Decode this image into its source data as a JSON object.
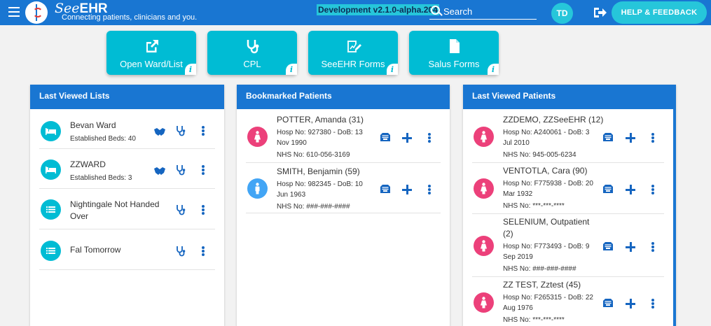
{
  "header": {
    "brand_name": "SeeEHR",
    "brand_prefix": "See",
    "brand_suffix": "EHR",
    "tagline": "Connecting patients, clinicians and you.",
    "environment": "Development v2.1.0-alpha.204",
    "search_placeholder": "Search",
    "avatar_initials": "TD",
    "help_label": "HELP & FEEDBACK"
  },
  "tiles": [
    {
      "label": "Open Ward/List",
      "icon": "external-link-icon"
    },
    {
      "label": "CPL",
      "icon": "stethoscope-icon"
    },
    {
      "label": "SeeEHR Forms",
      "icon": "form-edit-icon"
    },
    {
      "label": "Salus Forms",
      "icon": "document-icon"
    }
  ],
  "last_viewed_lists": {
    "title": "Last Viewed Lists",
    "items": [
      {
        "name": "Bevan Ward",
        "detail": "Established Beds: 40",
        "icon": "bed-icon"
      },
      {
        "name": "ZZWARD",
        "detail": "Established Beds: 3",
        "icon": "bed-icon"
      },
      {
        "name": "Nightingale Not Handed",
        "name_line2": "Over",
        "detail": "",
        "icon": "list-icon"
      },
      {
        "name": "Fal Tomorrow",
        "detail": "",
        "icon": "list-icon"
      }
    ]
  },
  "bookmarked_patients": {
    "title": "Bookmarked Patients",
    "items": [
      {
        "name": "POTTER, Amanda (31)",
        "hosp_line1": "Hosp No: 927380 - DoB: 13",
        "hosp_line2": "Nov 1990",
        "nhs": "NHS No: 610-056-3169",
        "gender": "female"
      },
      {
        "name": "SMITH, Benjamin (59)",
        "hosp_line1": "Hosp No: 982345 - DoB: 10",
        "hosp_line2": "Jun 1963",
        "nhs": "NHS No: ###-###-####",
        "gender": "male"
      }
    ]
  },
  "last_viewed_patients": {
    "title": "Last Viewed Patients",
    "items": [
      {
        "name": "ZZDEMO, ZZSeeEHR (12)",
        "hosp_line1": "Hosp No: A240061 - DoB: 3",
        "hosp_line2": "Jul 2010",
        "nhs": "NHS No: 945-005-6234",
        "gender": "female"
      },
      {
        "name": "VENTOTLA, Cara (90)",
        "hosp_line1": "Hosp No: F775938 - DoB: 20",
        "hosp_line2": "Mar 1932",
        "nhs": "NHS No: ***-***-****",
        "gender": "female"
      },
      {
        "name": "SELENIUM, Outpatient",
        "name_line2": "(2)",
        "hosp_line1": "Hosp No: F773493 - DoB: 9",
        "hosp_line2": "Sep 2019",
        "nhs": "NHS No: ###-###-####",
        "gender": "female"
      },
      {
        "name": "ZZ TEST, Zztest (45)",
        "hosp_line1": "Hosp No: F265315 - DoB: 22",
        "hosp_line2": "Aug 1976",
        "nhs": "NHS No: ***-***-****",
        "gender": "female"
      }
    ]
  },
  "colors": {
    "primary": "#1976d2",
    "accent": "#00bcd4",
    "female": "#ec407a",
    "male": "#42a5f5",
    "action": "#1565c0"
  }
}
